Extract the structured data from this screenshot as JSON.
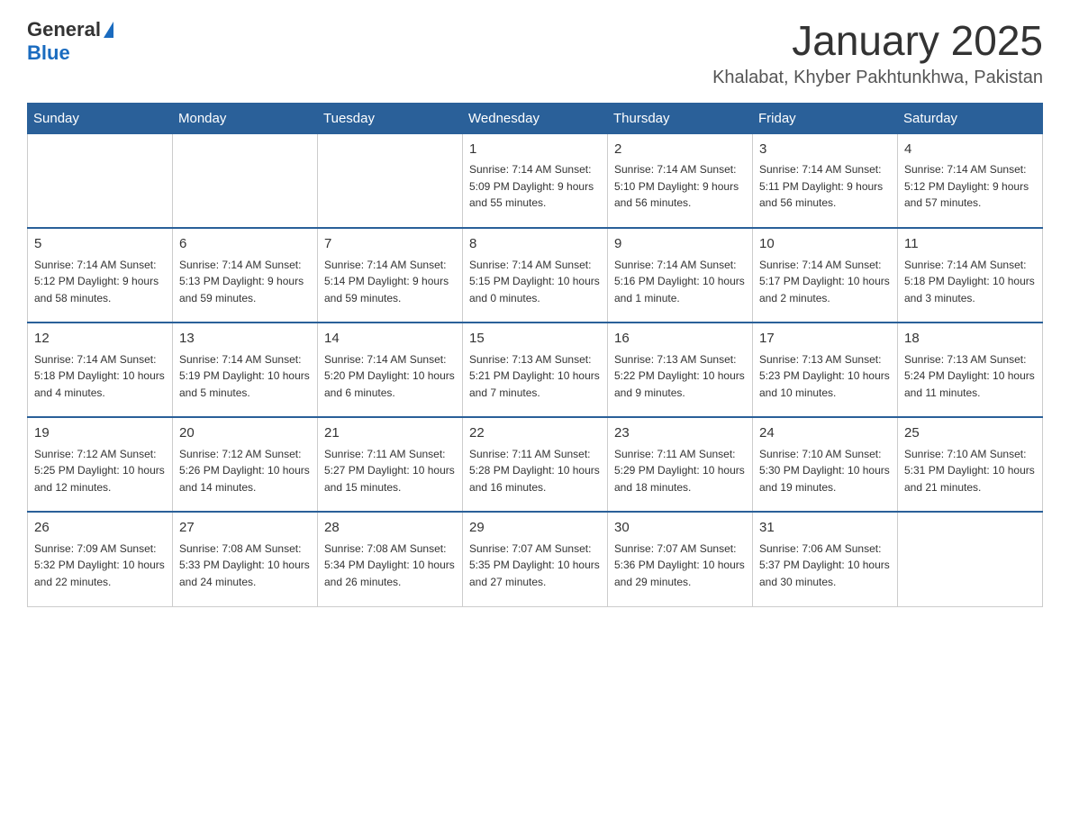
{
  "header": {
    "logo_general": "General",
    "logo_blue": "Blue",
    "title": "January 2025",
    "subtitle": "Khalabat, Khyber Pakhtunkhwa, Pakistan"
  },
  "weekdays": [
    "Sunday",
    "Monday",
    "Tuesday",
    "Wednesday",
    "Thursday",
    "Friday",
    "Saturday"
  ],
  "weeks": [
    [
      {
        "day": "",
        "info": ""
      },
      {
        "day": "",
        "info": ""
      },
      {
        "day": "",
        "info": ""
      },
      {
        "day": "1",
        "info": "Sunrise: 7:14 AM\nSunset: 5:09 PM\nDaylight: 9 hours\nand 55 minutes."
      },
      {
        "day": "2",
        "info": "Sunrise: 7:14 AM\nSunset: 5:10 PM\nDaylight: 9 hours\nand 56 minutes."
      },
      {
        "day": "3",
        "info": "Sunrise: 7:14 AM\nSunset: 5:11 PM\nDaylight: 9 hours\nand 56 minutes."
      },
      {
        "day": "4",
        "info": "Sunrise: 7:14 AM\nSunset: 5:12 PM\nDaylight: 9 hours\nand 57 minutes."
      }
    ],
    [
      {
        "day": "5",
        "info": "Sunrise: 7:14 AM\nSunset: 5:12 PM\nDaylight: 9 hours\nand 58 minutes."
      },
      {
        "day": "6",
        "info": "Sunrise: 7:14 AM\nSunset: 5:13 PM\nDaylight: 9 hours\nand 59 minutes."
      },
      {
        "day": "7",
        "info": "Sunrise: 7:14 AM\nSunset: 5:14 PM\nDaylight: 9 hours\nand 59 minutes."
      },
      {
        "day": "8",
        "info": "Sunrise: 7:14 AM\nSunset: 5:15 PM\nDaylight: 10 hours\nand 0 minutes."
      },
      {
        "day": "9",
        "info": "Sunrise: 7:14 AM\nSunset: 5:16 PM\nDaylight: 10 hours\nand 1 minute."
      },
      {
        "day": "10",
        "info": "Sunrise: 7:14 AM\nSunset: 5:17 PM\nDaylight: 10 hours\nand 2 minutes."
      },
      {
        "day": "11",
        "info": "Sunrise: 7:14 AM\nSunset: 5:18 PM\nDaylight: 10 hours\nand 3 minutes."
      }
    ],
    [
      {
        "day": "12",
        "info": "Sunrise: 7:14 AM\nSunset: 5:18 PM\nDaylight: 10 hours\nand 4 minutes."
      },
      {
        "day": "13",
        "info": "Sunrise: 7:14 AM\nSunset: 5:19 PM\nDaylight: 10 hours\nand 5 minutes."
      },
      {
        "day": "14",
        "info": "Sunrise: 7:14 AM\nSunset: 5:20 PM\nDaylight: 10 hours\nand 6 minutes."
      },
      {
        "day": "15",
        "info": "Sunrise: 7:13 AM\nSunset: 5:21 PM\nDaylight: 10 hours\nand 7 minutes."
      },
      {
        "day": "16",
        "info": "Sunrise: 7:13 AM\nSunset: 5:22 PM\nDaylight: 10 hours\nand 9 minutes."
      },
      {
        "day": "17",
        "info": "Sunrise: 7:13 AM\nSunset: 5:23 PM\nDaylight: 10 hours\nand 10 minutes."
      },
      {
        "day": "18",
        "info": "Sunrise: 7:13 AM\nSunset: 5:24 PM\nDaylight: 10 hours\nand 11 minutes."
      }
    ],
    [
      {
        "day": "19",
        "info": "Sunrise: 7:12 AM\nSunset: 5:25 PM\nDaylight: 10 hours\nand 12 minutes."
      },
      {
        "day": "20",
        "info": "Sunrise: 7:12 AM\nSunset: 5:26 PM\nDaylight: 10 hours\nand 14 minutes."
      },
      {
        "day": "21",
        "info": "Sunrise: 7:11 AM\nSunset: 5:27 PM\nDaylight: 10 hours\nand 15 minutes."
      },
      {
        "day": "22",
        "info": "Sunrise: 7:11 AM\nSunset: 5:28 PM\nDaylight: 10 hours\nand 16 minutes."
      },
      {
        "day": "23",
        "info": "Sunrise: 7:11 AM\nSunset: 5:29 PM\nDaylight: 10 hours\nand 18 minutes."
      },
      {
        "day": "24",
        "info": "Sunrise: 7:10 AM\nSunset: 5:30 PM\nDaylight: 10 hours\nand 19 minutes."
      },
      {
        "day": "25",
        "info": "Sunrise: 7:10 AM\nSunset: 5:31 PM\nDaylight: 10 hours\nand 21 minutes."
      }
    ],
    [
      {
        "day": "26",
        "info": "Sunrise: 7:09 AM\nSunset: 5:32 PM\nDaylight: 10 hours\nand 22 minutes."
      },
      {
        "day": "27",
        "info": "Sunrise: 7:08 AM\nSunset: 5:33 PM\nDaylight: 10 hours\nand 24 minutes."
      },
      {
        "day": "28",
        "info": "Sunrise: 7:08 AM\nSunset: 5:34 PM\nDaylight: 10 hours\nand 26 minutes."
      },
      {
        "day": "29",
        "info": "Sunrise: 7:07 AM\nSunset: 5:35 PM\nDaylight: 10 hours\nand 27 minutes."
      },
      {
        "day": "30",
        "info": "Sunrise: 7:07 AM\nSunset: 5:36 PM\nDaylight: 10 hours\nand 29 minutes."
      },
      {
        "day": "31",
        "info": "Sunrise: 7:06 AM\nSunset: 5:37 PM\nDaylight: 10 hours\nand 30 minutes."
      },
      {
        "day": "",
        "info": ""
      }
    ]
  ]
}
